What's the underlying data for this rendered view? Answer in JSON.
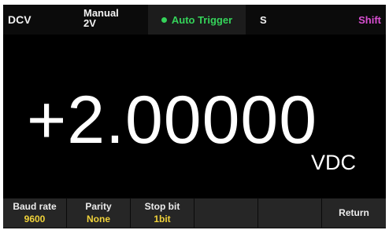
{
  "status_bar": {
    "mode": "DCV",
    "range_line1": "Manual",
    "range_line2": "2V",
    "trigger": "Auto Trigger",
    "speed": "S",
    "shift": "Shift"
  },
  "display": {
    "reading": "+2.00000",
    "unit": "VDC"
  },
  "softkeys": [
    {
      "label": "Baud rate",
      "value": "9600"
    },
    {
      "label": "Parity",
      "value": "None"
    },
    {
      "label": "Stop bit",
      "value": "1bit"
    },
    {
      "label": "",
      "value": ""
    },
    {
      "label": "",
      "value": ""
    },
    {
      "label": "Return",
      "value": ""
    }
  ],
  "colors": {
    "screen_bg": "#000000",
    "trigger_green": "#35d35a",
    "shift_magenta": "#d94fd2",
    "value_yellow": "#f0d23a",
    "softkey_bg": "#262626"
  }
}
